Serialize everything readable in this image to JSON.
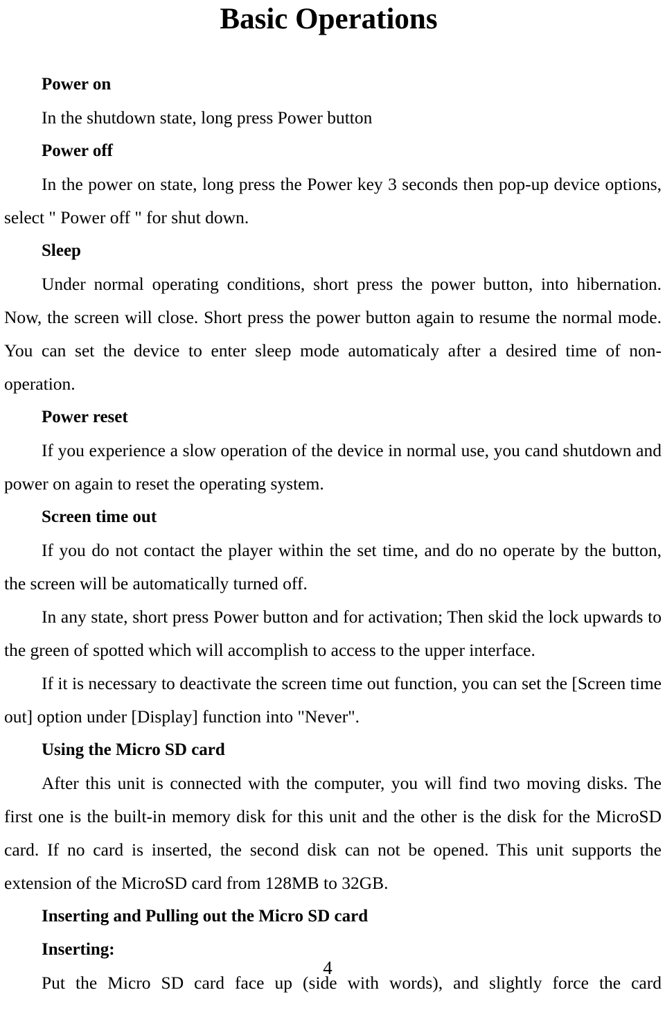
{
  "document": {
    "title": "Basic Operations",
    "page_number": "4",
    "sections": [
      {
        "heading": "Power on",
        "body": "In the shutdown state, long press Power button"
      },
      {
        "heading": "Power off",
        "body": "In the power on state, long press the Power key 3 seconds then pop-up device options, select \" Power off \" for shut down."
      },
      {
        "heading": "Sleep",
        "body": "Under normal operating conditions, short press the power button, into hibernation. Now, the screen will close. Short press the power button again to resume the normal mode. You can set the device to enter sleep mode automaticaly after a desired time of non-operation."
      },
      {
        "heading": "Power reset",
        "body": "If you experience a slow operation of the device in normal use, you cand shutdown and power on again to reset the operating system."
      },
      {
        "heading": "Screen time out",
        "body": "If you do not contact the player within the set time, and do no operate by the button, the screen will be automatically turned off.",
        "body2": "In any state, short press Power button and for activation; Then skid the lock upwards to the green of spotted which will accomplish to access to the upper interface.",
        "body3": "If it is necessary to deactivate the screen time out function, you can set the [Screen time out] option under [Display] function into \"Never\"."
      },
      {
        "heading": "Using the Micro SD card",
        "body": "After this unit is connected with the computer, you will find two moving disks. The first one is the built-in memory disk for this unit and the other is the disk for the MicroSD card. If no card is inserted, the second disk can not be opened. This unit supports the extension of the MicroSD card from 128MB to 32GB."
      },
      {
        "heading": "Inserting and Pulling out the Micro SD card",
        "subheading": "Inserting:",
        "body": "Put the Micro SD card face up (side with words), and slightly force the card"
      }
    ]
  }
}
